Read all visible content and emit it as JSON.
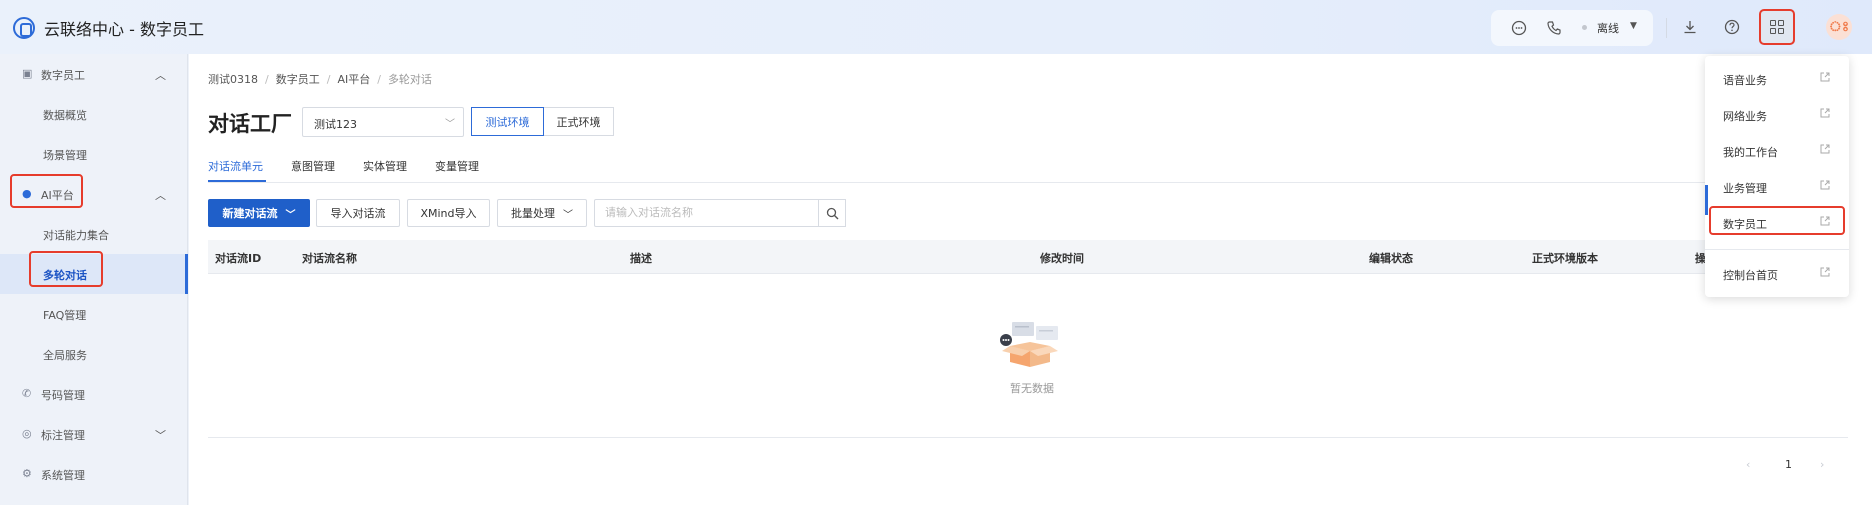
{
  "header": {
    "app_title": "云联络中心 - 数字员工",
    "status": "离线",
    "icons": [
      "chat-icon",
      "phone-icon",
      "download-icon",
      "help-icon",
      "apps-grid-icon"
    ]
  },
  "sidebar": {
    "items": [
      {
        "label": "数字员工",
        "icon": "robot-icon",
        "expanded": true
      },
      {
        "label": "数据概览"
      },
      {
        "label": "场景管理"
      },
      {
        "label": "AI平台",
        "icon": "ai-icon",
        "expanded": true
      },
      {
        "label": "对话能力集合"
      },
      {
        "label": "多轮对话",
        "active": true
      },
      {
        "label": "FAQ管理"
      },
      {
        "label": "全局服务"
      },
      {
        "label": "号码管理",
        "icon": "phone-icon"
      },
      {
        "label": "标注管理",
        "icon": "tag-icon",
        "expanded": false
      },
      {
        "label": "系统管理",
        "icon": "gear-icon"
      }
    ]
  },
  "breadcrumb": [
    "测试0318",
    "数字员工",
    "AI平台",
    "多轮对话"
  ],
  "page": {
    "title": "对话工厂",
    "project_select": "测试123",
    "env_test": "测试环境",
    "env_prod": "正式环境",
    "active_env": "测试环境"
  },
  "tabs": [
    "对话流单元",
    "意图管理",
    "实体管理",
    "变量管理"
  ],
  "toolbar": {
    "new_flow": "新建对话流",
    "import_flow": "导入对话流",
    "xmind_import": "XMind导入",
    "batch": "批量处理",
    "search_placeholder": "请输入对话流名称"
  },
  "table": {
    "columns": [
      "对话流ID",
      "对话流名称",
      "描述",
      "修改时间",
      "编辑状态",
      "正式环境版本",
      "操"
    ],
    "rows": [],
    "empty_text": "暂无数据"
  },
  "pagination": {
    "prev": "‹",
    "page": "1",
    "next": "›"
  },
  "dropdown": {
    "items": [
      "语音业务",
      "网络业务",
      "我的工作台",
      "业务管理",
      "数字员工",
      "控制台首页"
    ]
  },
  "colors": {
    "accent": "#2d6bd8",
    "highlight": "#e63c2c",
    "primary_button": "#1f5fc9"
  }
}
